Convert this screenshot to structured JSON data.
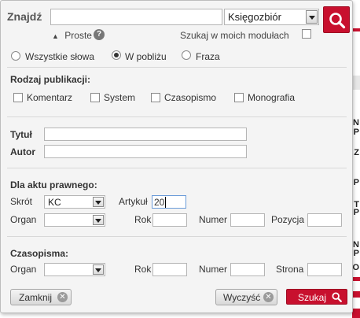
{
  "search": {
    "label": "Znajdź",
    "query_value": "",
    "scope_value": "Księgozbiór",
    "button_icon": "search-icon"
  },
  "options": {
    "simple_link": "Proste",
    "help_icon": "?",
    "modules_label": "Szukaj w moich modułach"
  },
  "match_mode": {
    "options": [
      "Wszystkie słowa",
      "W pobliżu",
      "Fraza"
    ],
    "selected": "W pobliżu"
  },
  "publication_type": {
    "heading": "Rodzaj publikacji:",
    "options": [
      "Komentarz",
      "System",
      "Czasopismo",
      "Monografia"
    ]
  },
  "fields": {
    "title_label": "Tytuł",
    "title_value": "",
    "author_label": "Autor",
    "author_value": ""
  },
  "legal_act": {
    "heading": "Dla aktu prawnego:",
    "abbrev_label": "Skrót",
    "abbrev_value": "KC",
    "article_label": "Artykuł",
    "article_value": "20",
    "organ_label": "Organ",
    "organ_value": "",
    "year_label": "Rok",
    "number_label": "Numer",
    "position_label": "Pozycja"
  },
  "journals": {
    "heading": "Czasopisma:",
    "organ_label": "Organ",
    "organ_value": "",
    "year_label": "Rok",
    "number_label": "Numer",
    "page_label": "Strona"
  },
  "buttons": {
    "close": "Zamknij",
    "clear": "Wyczyść",
    "search": "Szukaj"
  },
  "background_page": {
    "text_lines": [
      "N",
      "P",
      "Z",
      "P",
      "T",
      "P",
      "N",
      "P",
      "O"
    ]
  },
  "colors": {
    "accent": "#c8102e",
    "panel_bg": "#f4f4f4"
  }
}
